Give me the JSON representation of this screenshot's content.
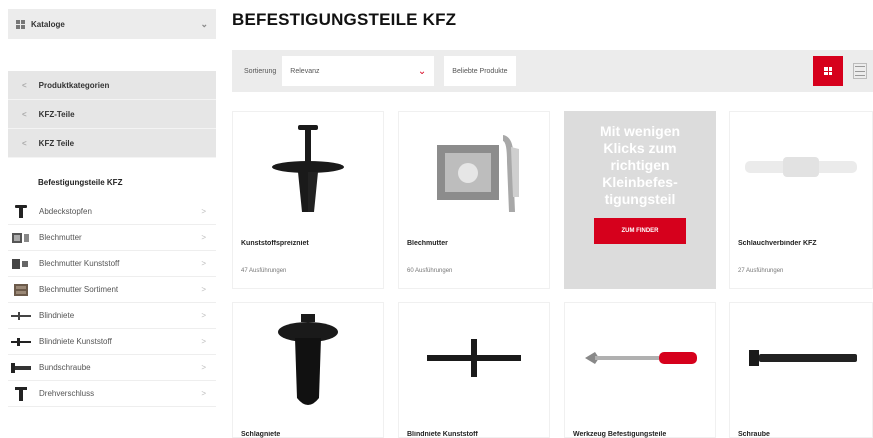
{
  "sidebar": {
    "catalog_label": "Kataloge",
    "crumbs": [
      {
        "label": "Produktkategorien"
      },
      {
        "label": "KFZ-Teile"
      },
      {
        "label": "KFZ Teile"
      }
    ],
    "current_category": "Befestigungsteile KFZ",
    "subcategories": [
      {
        "label": "Abdeckstopfen",
        "icon": "push-rivet-icon"
      },
      {
        "label": "Blechmutter",
        "icon": "sheet-nut-icon"
      },
      {
        "label": "Blechmutter Kunststoff",
        "icon": "plastic-sheet-nut-icon"
      },
      {
        "label": "Blechmutter Sortiment",
        "icon": "assortment-box-icon"
      },
      {
        "label": "Blindniete",
        "icon": "blind-rivet-icon"
      },
      {
        "label": "Blindniete Kunststoff",
        "icon": "plastic-blind-rivet-icon"
      },
      {
        "label": "Bundschraube",
        "icon": "flange-screw-icon"
      },
      {
        "label": "Drehverschluss",
        "icon": "twist-lock-icon"
      }
    ]
  },
  "page": {
    "title": "BEFESTIGUNGSTEILE KFZ"
  },
  "toolbar": {
    "sort_label": "Sortierung",
    "sort_value": "Relevanz",
    "popular_label": "Beliebte Produkte"
  },
  "products": [
    {
      "name": "Kunststoffspreizniet",
      "variants": "47 Ausführungen",
      "icon": "spreading-rivet-icon"
    },
    {
      "name": "Blechmutter",
      "variants": "60 Ausführungen",
      "icon": "sheet-nut-icon"
    },
    {
      "name": "Schlauchverbinder KFZ",
      "variants": "27 Ausführungen",
      "icon": "hose-connector-icon"
    },
    {
      "name": "Schlagniete",
      "variants": "",
      "icon": "drive-rivet-icon"
    },
    {
      "name": "Blindniete Kunststoff",
      "variants": "",
      "icon": "plastic-blind-rivet-icon"
    },
    {
      "name": "Werkzeug Befestigungsteile",
      "variants": "",
      "icon": "screwdriver-tool-icon"
    },
    {
      "name": "Schraube",
      "variants": "",
      "icon": "screw-icon"
    }
  ],
  "promo": {
    "text": "Mit wenigen Klicks zum richtigen Kleinbefes-tigungsteil",
    "button": "ZUM FINDER"
  },
  "colors": {
    "accent": "#d6001c",
    "panel": "#ececec",
    "promo_bg": "#dcdcdc"
  }
}
